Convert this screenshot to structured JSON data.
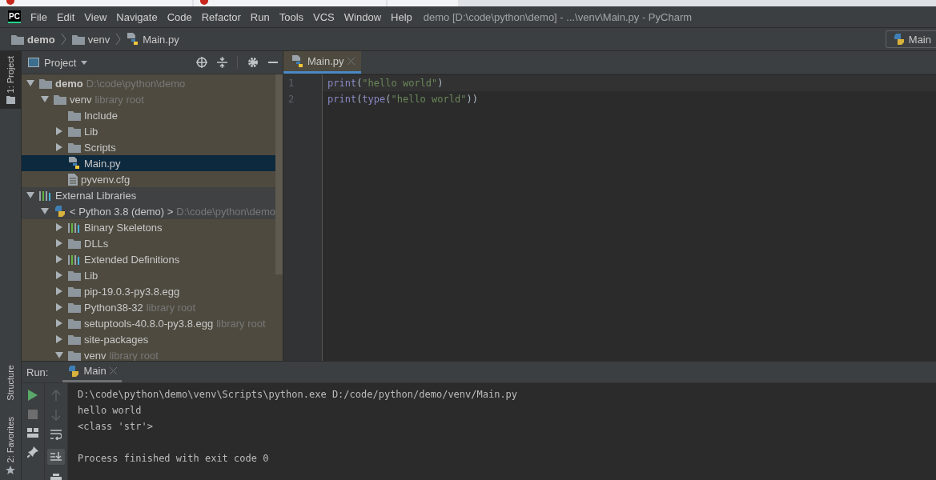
{
  "window": {
    "logo": "PC",
    "title": "demo [D:\\code\\python\\demo] - ...\\venv\\Main.py - PyCharm"
  },
  "menu": [
    "File",
    "Edit",
    "View",
    "Navigate",
    "Code",
    "Refactor",
    "Run",
    "Tools",
    "VCS",
    "Window",
    "Help"
  ],
  "breadcrumb": [
    {
      "label": "demo",
      "kind": "folder"
    },
    {
      "label": "venv",
      "kind": "folder"
    },
    {
      "label": "Main.py",
      "kind": "python-file"
    }
  ],
  "run_config": {
    "label": "Main"
  },
  "side_tabs_top": [
    {
      "label": "1: Project",
      "selected": true
    }
  ],
  "side_tabs_bottom": [
    {
      "label": "2: Favorites",
      "kind": "favorites",
      "selected": false
    },
    {
      "label": "Structure",
      "kind": "structure",
      "selected": false
    }
  ],
  "project": {
    "title": "Project",
    "tree": [
      {
        "name": "demo",
        "hint": "D:\\code\\python\\demo",
        "kind": "root",
        "expanded": true,
        "selected": false,
        "children": [
          {
            "name": "venv",
            "hint": "library root",
            "kind": "folder",
            "expanded": true,
            "selected": false,
            "children": [
              {
                "name": "Include",
                "kind": "folder",
                "selected": false
              },
              {
                "name": "Lib",
                "kind": "folder",
                "expanded": false,
                "selected": false
              },
              {
                "name": "Scripts",
                "kind": "folder",
                "expanded": false,
                "selected": false
              },
              {
                "name": "Main.py",
                "kind": "python-file",
                "selected": true
              },
              {
                "name": "pyvenv.cfg",
                "kind": "text-file",
                "selected": false
              }
            ]
          }
        ]
      },
      {
        "name": "External Libraries",
        "kind": "library",
        "expanded": true,
        "selected": false,
        "children": [
          {
            "name": "< Python 3.8 (demo) >",
            "hint": "D:\\code\\python\\demo",
            "kind": "python-sdk",
            "expanded": true,
            "selected": false,
            "children": [
              {
                "name": "Binary Skeletons",
                "kind": "skeleton",
                "expanded": false,
                "selected": false
              },
              {
                "name": "DLLs",
                "kind": "folder",
                "expanded": false,
                "selected": false
              },
              {
                "name": "Extended Definitions",
                "kind": "skeleton",
                "expanded": false,
                "selected": false
              },
              {
                "name": "Lib",
                "kind": "folder",
                "expanded": false,
                "selected": false
              },
              {
                "name": "pip-19.0.3-py3.8.egg",
                "kind": "folder",
                "expanded": false,
                "selected": false
              },
              {
                "name": "Python38-32",
                "hint": "library root",
                "kind": "folder",
                "expanded": false,
                "selected": false
              },
              {
                "name": "setuptools-40.8.0-py3.8.egg",
                "hint": "library root",
                "kind": "folder",
                "expanded": false,
                "selected": false
              },
              {
                "name": "site-packages",
                "kind": "folder",
                "expanded": false,
                "selected": false
              },
              {
                "name": "venv",
                "hint": "library root",
                "kind": "folder",
                "expanded": true,
                "selected": false
              }
            ]
          }
        ]
      }
    ]
  },
  "editor": {
    "tabs": [
      {
        "label": "Main.py",
        "selected": true
      }
    ],
    "lines": [
      {
        "number": "1",
        "tokens": [
          {
            "text": "print",
            "color": "#8888c6"
          },
          {
            "text": "(",
            "color": "#a9b7c6"
          },
          {
            "text": "\"hello world\"",
            "color": "#6a8759"
          },
          {
            "text": ")",
            "color": "#a9b7c6"
          }
        ]
      },
      {
        "number": "2",
        "tokens": [
          {
            "text": "print",
            "color": "#8888c6"
          },
          {
            "text": "(",
            "color": "#a9b7c6"
          },
          {
            "text": "type",
            "color": "#8888c6"
          },
          {
            "text": "(",
            "color": "#a9b7c6"
          },
          {
            "text": "\"hello world\"",
            "color": "#6a8759"
          },
          {
            "text": "))",
            "color": "#a9b7c6"
          }
        ]
      }
    ]
  },
  "run": {
    "label": "Run:",
    "tabs": [
      {
        "label": "Main",
        "selected": true
      }
    ],
    "output": [
      {
        "text": "D:\\code\\python\\demo\\venv\\Scripts\\python.exe D:/code/python/demo/venv/Main.py",
        "kind": "command"
      },
      {
        "text": "hello world",
        "kind": "stdout"
      },
      {
        "text": "<class 'str'>",
        "kind": "stdout"
      },
      {
        "text": "Process finished with exit code 0",
        "kind": "exit"
      }
    ]
  }
}
